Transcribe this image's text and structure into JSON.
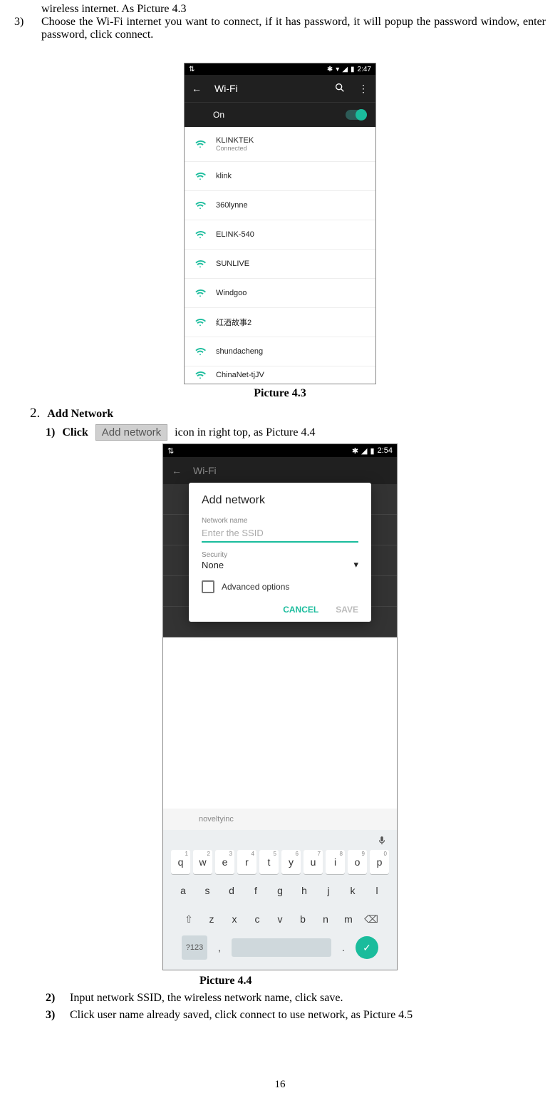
{
  "intro_fragment": "wireless internet. As Picture 4.3",
  "step3_num": "3)",
  "step3_text": "Choose the Wi-Fi internet you want to connect, if it has password, it will popup the password window, enter password, click connect.",
  "caption43": "Picture 4.3",
  "phone1": {
    "time": "2:47",
    "title": "Wi-Fi",
    "on": "On",
    "list": [
      {
        "name": "KLINKTEK",
        "sub": "Connected"
      },
      {
        "name": "klink"
      },
      {
        "name": "360lynne"
      },
      {
        "name": "ELINK-540"
      },
      {
        "name": "SUNLIVE"
      },
      {
        "name": "Windgoo"
      },
      {
        "name": "红酒故事2"
      },
      {
        "name": "shundacheng"
      },
      {
        "name": "ChinaNet-tjJV"
      }
    ]
  },
  "section2": {
    "num": "2.",
    "title": "Add Network",
    "step1_num": "1)",
    "step1_a": "Click",
    "step1_btn": "Add network",
    "step1_b": "icon in right top, as Picture 4.4"
  },
  "phone2": {
    "time": "2:54",
    "bg_title": "Wi-Fi",
    "dialog_title": "Add network",
    "nn_label": "Network name",
    "nn_placeholder": "Enter the SSID",
    "sec_label": "Security",
    "sec_value": "None",
    "adv": "Advanced options",
    "cancel": "CANCEL",
    "save": "SAVE",
    "below_name": "noveltyinc",
    "kbd_r1": [
      "q",
      "w",
      "e",
      "r",
      "t",
      "y",
      "u",
      "i",
      "o",
      "p"
    ],
    "kbd_r1_sup": [
      "1",
      "2",
      "3",
      "4",
      "5",
      "6",
      "7",
      "8",
      "9",
      "0"
    ],
    "kbd_r2": [
      "a",
      "s",
      "d",
      "f",
      "g",
      "h",
      "j",
      "k",
      "l"
    ],
    "kbd_r3": [
      "z",
      "x",
      "c",
      "v",
      "b",
      "n",
      "m"
    ],
    "k123": "?123"
  },
  "caption44": "Picture 4.4",
  "step2_num": "2)",
  "step2_text": "Input network SSID, the wireless network name, click save.",
  "step3b_num": "3)",
  "step3b_text": "Click user name already saved, click connect to use network, as Picture 4.5",
  "page_number": "16"
}
